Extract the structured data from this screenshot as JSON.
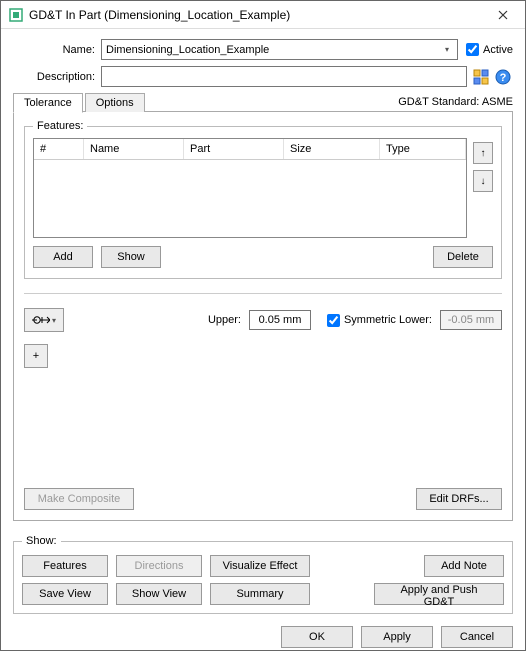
{
  "window": {
    "title": "GD&T In Part (Dimensioning_Location_Example)"
  },
  "form": {
    "name_label": "Name:",
    "name_value": "Dimensioning_Location_Example",
    "active_label": "Active",
    "active_checked": true,
    "description_label": "Description:",
    "description_value": ""
  },
  "tabs": {
    "tolerance": "Tolerance",
    "options": "Options"
  },
  "std_label": "GD&T Standard: ASME",
  "features": {
    "legend": "Features:",
    "columns": {
      "num": "#",
      "name": "Name",
      "part": "Part",
      "size": "Size",
      "type": "Type"
    },
    "rows": [],
    "add": "Add",
    "show": "Show",
    "delete": "Delete"
  },
  "tol": {
    "upper_label": "Upper:",
    "upper_value": "0.05 mm",
    "sym_label": "Symmetric Lower:",
    "sym_checked": true,
    "lower_value": "-0.05 mm",
    "plus": "+"
  },
  "composite": {
    "make": "Make Composite",
    "edit_drfs": "Edit DRFs..."
  },
  "show": {
    "legend": "Show:",
    "features": "Features",
    "directions": "Directions",
    "visualize": "Visualize Effect",
    "add_note": "Add Note",
    "save_view": "Save View",
    "show_view": "Show View",
    "summary": "Summary",
    "apply_push": "Apply and Push GD&T"
  },
  "dialog": {
    "ok": "OK",
    "apply": "Apply",
    "cancel": "Cancel"
  }
}
